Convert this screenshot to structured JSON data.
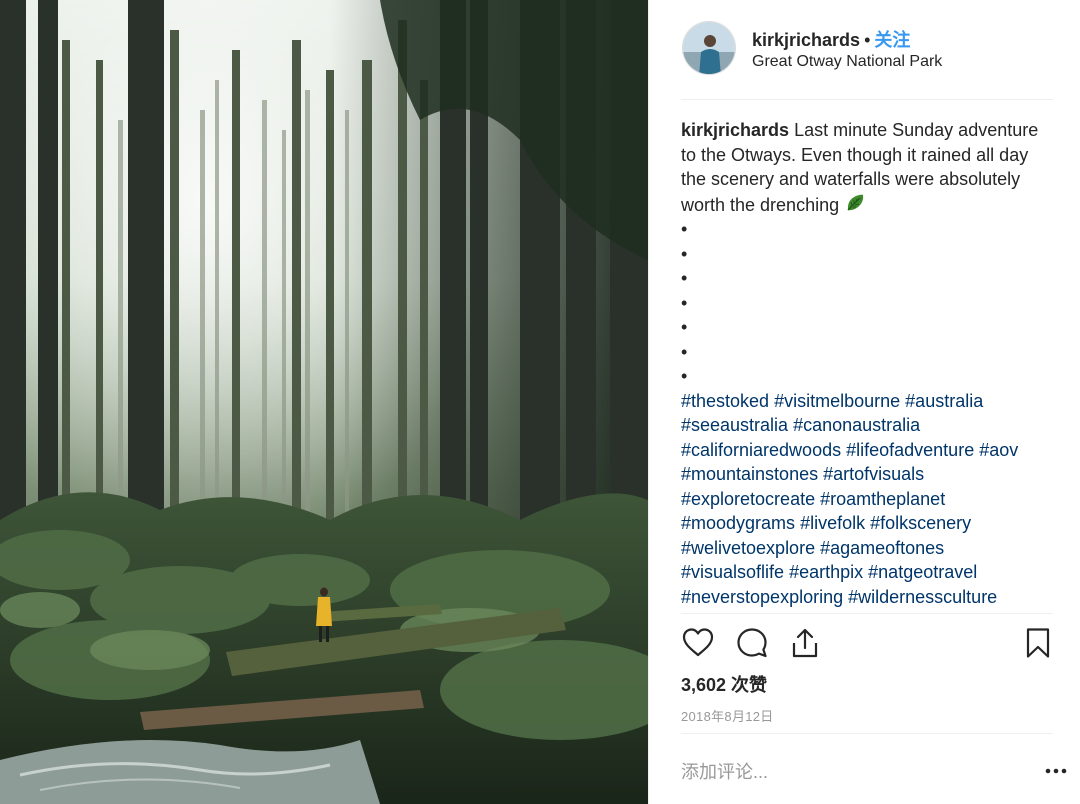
{
  "post": {
    "username": "kirkjrichards",
    "separator": "•",
    "follow_label": "关注",
    "location": "Great Otway National Park"
  },
  "caption": {
    "username": "kirkjrichards",
    "text": "Last minute Sunday adventure to the Otways. Even though it rained all day the scenery and waterfalls were absolutely worth the drenching",
    "emoji_icon": "leaf-icon",
    "bullets": [
      "•",
      "•",
      "•",
      "•",
      "•",
      "•",
      "•"
    ],
    "hashtag_lines": [
      [
        "#thestoked",
        "#visitmelbourne",
        "#australia"
      ],
      [
        "#seeaustralia",
        "#canonaustralia"
      ],
      [
        "#californiaredwoods",
        "#lifeofadventure",
        "#aov"
      ],
      [
        "#mountainstones",
        "#artofvisuals"
      ],
      [
        "#exploretocreate",
        "#roamtheplanet"
      ],
      [
        "#moodygrams",
        "#livefolk",
        "#folkscenery"
      ],
      [
        "#welivetoexplore",
        "#agameoftones"
      ],
      [
        "#visualsoflife",
        "#earthpix",
        "#natgeotravel"
      ],
      [
        "#neverstopexploring",
        "#wildernessculture"
      ]
    ]
  },
  "actions": {
    "like_icon": "heart-icon",
    "comment_icon": "comment-bubble-icon",
    "share_icon": "share-upload-icon",
    "save_icon": "bookmark-icon"
  },
  "likes_text": "3,602 次赞",
  "date_text": "2018年8月12日",
  "comment_input": {
    "placeholder": "添加评论...",
    "value": ""
  },
  "more_icon": "more-options-icon",
  "colors": {
    "link": "#003569",
    "follow": "#3897f0",
    "text": "#262626",
    "muted": "#999999",
    "divider": "#efefef"
  }
}
